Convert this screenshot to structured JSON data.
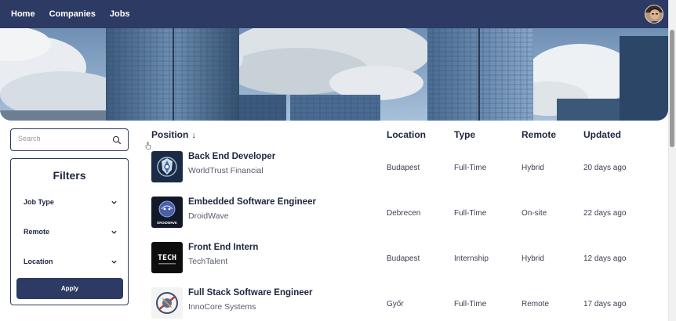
{
  "nav": {
    "links": [
      "Home",
      "Companies",
      "Jobs"
    ]
  },
  "search": {
    "placeholder": "Search"
  },
  "filters": {
    "title": "Filters",
    "items": [
      "Job Type",
      "Remote",
      "Location"
    ],
    "apply_label": "Apply"
  },
  "table": {
    "headers": {
      "position": "Position",
      "location": "Location",
      "type": "Type",
      "remote": "Remote",
      "updated": "Updated"
    },
    "sort_indicator": "↓",
    "rows": [
      {
        "title": "Back End Developer",
        "company": "WorldTrust Financial",
        "location": "Budapest",
        "type": "Full-Time",
        "remote": "Hybrid",
        "updated": "20 days ago",
        "logo_icon": "shield-compass-logo-icon"
      },
      {
        "title": "Embedded Software Engineer",
        "company": "DroidWave",
        "location": "Debrecen",
        "type": "Full-Time",
        "remote": "On-site",
        "updated": "22 days ago",
        "logo_icon": "droidwave-logo-icon",
        "logo_text": "DROIDWAVE"
      },
      {
        "title": "Front End Intern",
        "company": "TechTalent",
        "location": "Budapest",
        "type": "Internship",
        "remote": "Hybrid",
        "updated": "12 days ago",
        "logo_icon": "techtalent-logo-icon",
        "logo_text": "TECH"
      },
      {
        "title": "Full Stack Software Engineer",
        "company": "InnoCore Systems",
        "location": "Győr",
        "type": "Full-Time",
        "remote": "Remote",
        "updated": "17 days ago",
        "logo_icon": "innocore-logo-icon"
      }
    ]
  },
  "colors": {
    "navbar": "#2d3a63",
    "primary": "#2d3a63",
    "text_dark": "#1f2540"
  }
}
